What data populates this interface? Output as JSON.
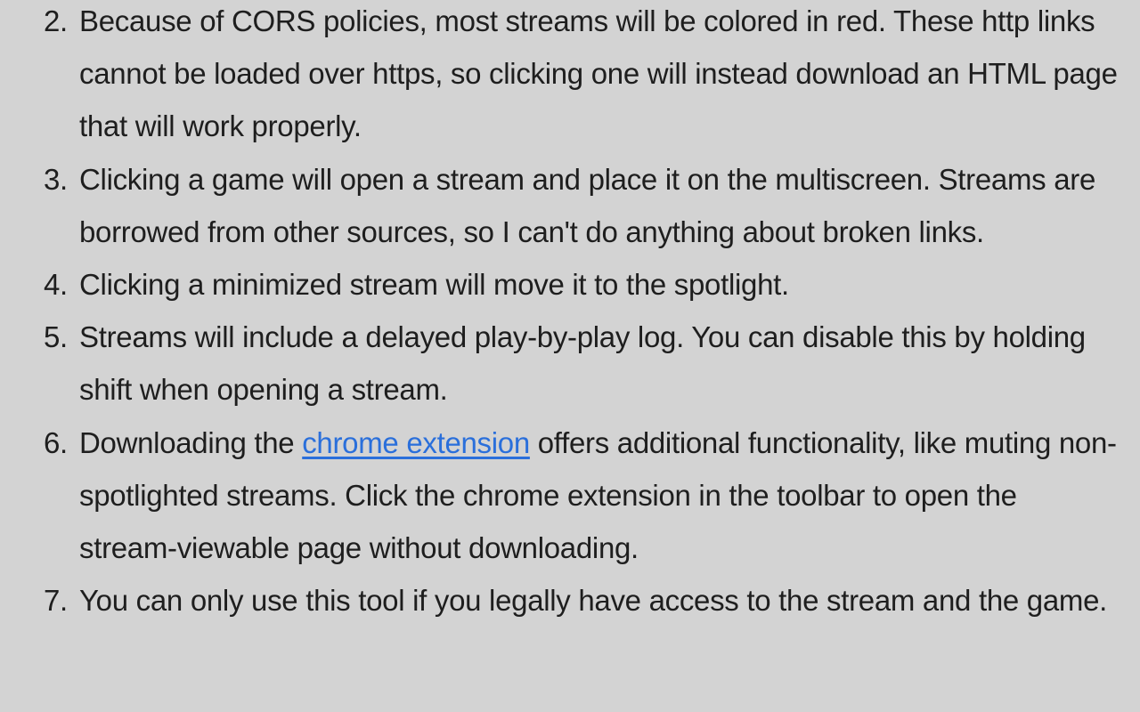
{
  "instructions": {
    "items": [
      {
        "number": "2.",
        "text": "Because of CORS policies, most streams will be colored in red. These http links cannot be loaded over https, so clicking one will instead download an HTML page that will work properly."
      },
      {
        "number": "3.",
        "text": "Clicking a game will open a stream and place it on the multiscreen. Streams are borrowed from other sources, so I can't do anything about broken links."
      },
      {
        "number": "4.",
        "text": "Clicking a minimized stream will move it to the spotlight."
      },
      {
        "number": "5.",
        "text": "Streams will include a delayed play-by-play log. You can disable this by holding shift when opening a stream."
      },
      {
        "number": "6.",
        "text_before": "Downloading the ",
        "link_text": "chrome extension",
        "text_after": " offers additional functionality, like muting non-spotlighted streams. Click the chrome extension in the toolbar to open the stream-viewable page without downloading."
      },
      {
        "number": "7.",
        "text": "You can only use this tool if you legally have access to the stream and the game."
      }
    ]
  },
  "colors": {
    "background": "#d3d3d3",
    "text": "#1e1e1e",
    "link": "#2a6fdb"
  }
}
